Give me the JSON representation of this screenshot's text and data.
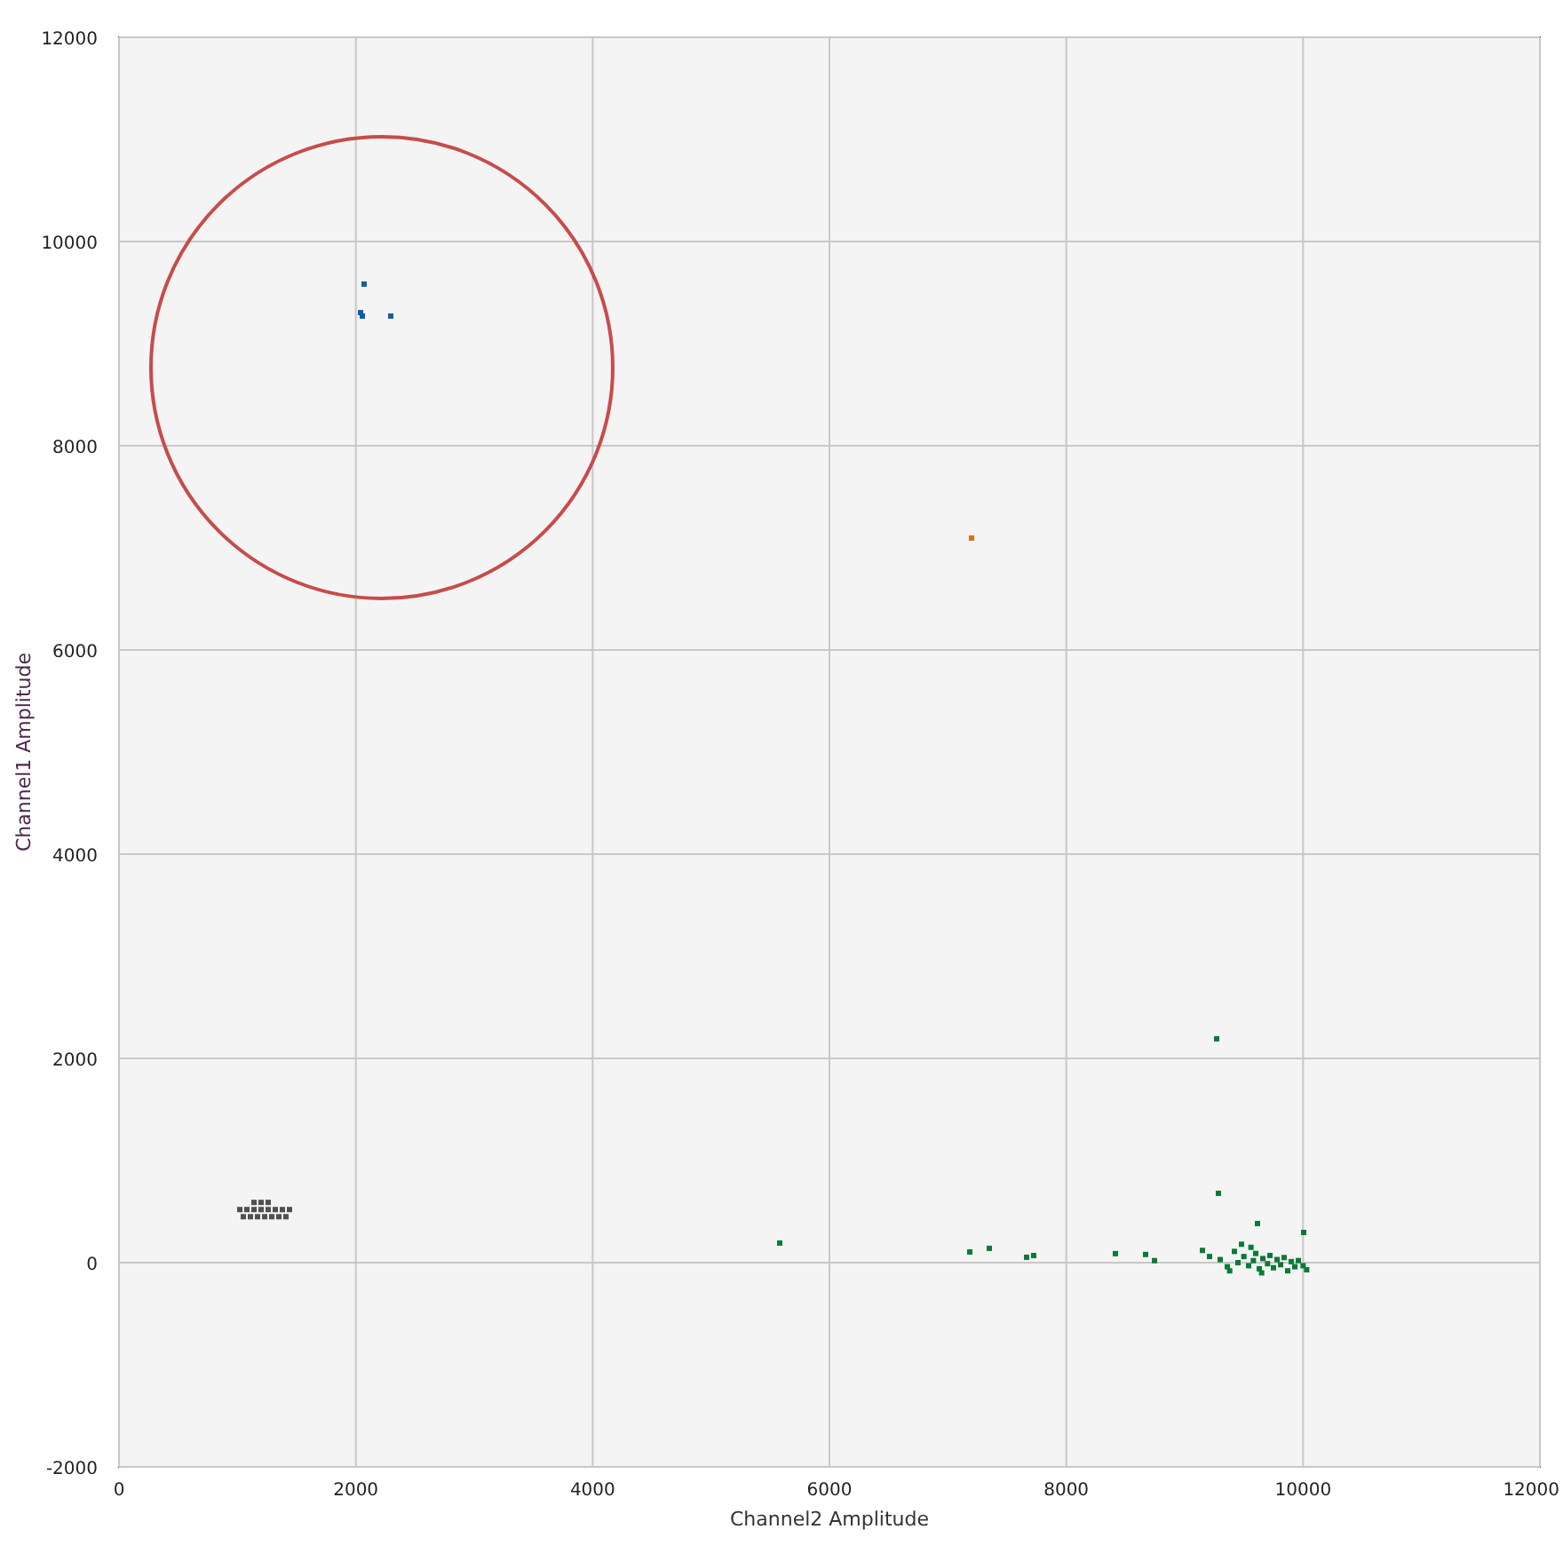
{
  "chart_data": {
    "type": "scatter",
    "grid": true,
    "xlabel": "Channel2 Amplitude",
    "ylabel": "Channel1 Amplitude",
    "xlim": [
      0,
      12000
    ],
    "ylim": [
      -2000,
      12000
    ],
    "xticks": [
      0,
      2000,
      4000,
      6000,
      8000,
      10000,
      12000
    ],
    "yticks": [
      -2000,
      0,
      2000,
      4000,
      6000,
      8000,
      10000,
      12000
    ],
    "series": [
      {
        "color": "#0e5fa8",
        "x": [
          2070,
          2040,
          2055,
          2295
        ],
        "values": [
          9583,
          9304,
          9270,
          9270
        ]
      },
      {
        "color": "#e06a1a",
        "x": [
          7200
        ],
        "values": [
          7096
        ]
      },
      {
        "color": "#0a7a38",
        "x": [
          5580,
          7185,
          7350,
          7665,
          7725,
          8415,
          8670,
          8745,
          9270,
          9285,
          9615,
          10005,
          9150,
          9210,
          9300,
          9360,
          9420,
          9450,
          9500,
          9540,
          9580,
          9600,
          9630,
          9660,
          9700,
          9720,
          9750,
          9780,
          9810,
          9840,
          9870,
          9900,
          9930,
          9960,
          10000,
          10030,
          9480,
          9560,
          9650,
          9380
        ],
        "values": [
          192,
          105,
          140,
          53,
          70,
          88,
          80,
          20,
          2192,
          679,
          383,
          296,
          120,
          60,
          30,
          -40,
          110,
          0,
          60,
          -30,
          20,
          90,
          -60,
          40,
          -10,
          70,
          -50,
          30,
          -20,
          50,
          -80,
          10,
          -40,
          20,
          -30,
          -70,
          180,
          150,
          -100,
          -80
        ]
      },
      {
        "color": "#505050",
        "x": [
          1020,
          1080,
          1140,
          1200,
          1260,
          1320,
          1380,
          1440,
          1050,
          1110,
          1170,
          1230,
          1290,
          1350,
          1410,
          1140,
          1200,
          1260
        ],
        "values": [
          520,
          520,
          520,
          520,
          520,
          520,
          520,
          520,
          450,
          450,
          450,
          450,
          450,
          450,
          450,
          590,
          590,
          590
        ]
      }
    ]
  }
}
